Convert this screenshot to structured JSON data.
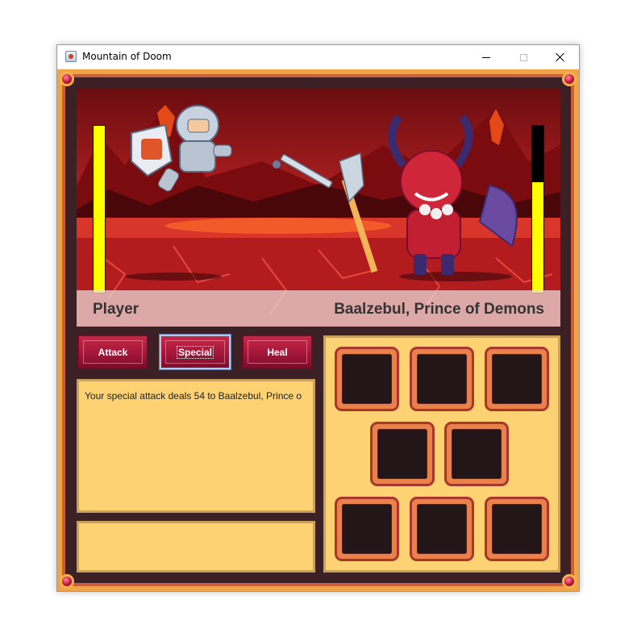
{
  "window": {
    "title": "Mountain of Doom"
  },
  "battle": {
    "player": {
      "name": "Player",
      "hp_fraction": 1.0
    },
    "enemy": {
      "name": "Baalzebul, Prince of Demons",
      "hp_fraction": 0.66
    }
  },
  "actions": {
    "attack_label": "Attack",
    "special_label": "Special",
    "heal_label": "Heal",
    "focused": "Special"
  },
  "log": {
    "message": "Your special attack deals 54 to Baalzebul, Prince o"
  },
  "status": {
    "text": ""
  },
  "inventory": {
    "slot_count": 8
  },
  "colors": {
    "hp_fill": "#ffff00",
    "panel": "#fcd273",
    "button": "#a0153a",
    "frame": "#3b2125"
  }
}
